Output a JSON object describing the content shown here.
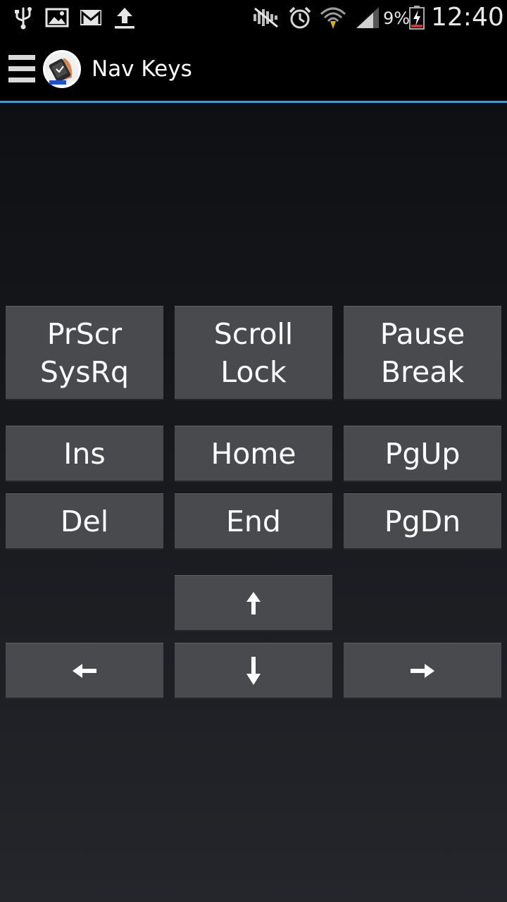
{
  "status_bar": {
    "icons_left": [
      "usb-icon",
      "gallery-icon",
      "gmail-icon",
      "upload-icon"
    ],
    "icons_right": [
      "mute-icon",
      "alarm-icon",
      "wifi-icon",
      "signal-icon",
      "battery-charging-icon"
    ],
    "battery_percent": "9%",
    "time": "12:40"
  },
  "action_bar": {
    "menu_icon": "drawer-menu-icon",
    "logo_icon": "app-logo-icon",
    "title": "Nav Keys",
    "divider_color": "#3a9fd8"
  },
  "keys": {
    "prscr": [
      "PrScr",
      "SysRq"
    ],
    "scroll_lock": [
      "Scroll",
      "Lock"
    ],
    "pause_break": [
      "Pause",
      "Break"
    ],
    "ins": "Ins",
    "home": "Home",
    "pgup": "PgUp",
    "del": "Del",
    "end": "End",
    "pgdn": "PgDn",
    "up": "arrow-up-icon",
    "left": "arrow-left-icon",
    "down": "arrow-down-icon",
    "right": "arrow-right-icon"
  },
  "colors": {
    "key_background": "#484a4e",
    "accent": "#3a9fd8"
  }
}
